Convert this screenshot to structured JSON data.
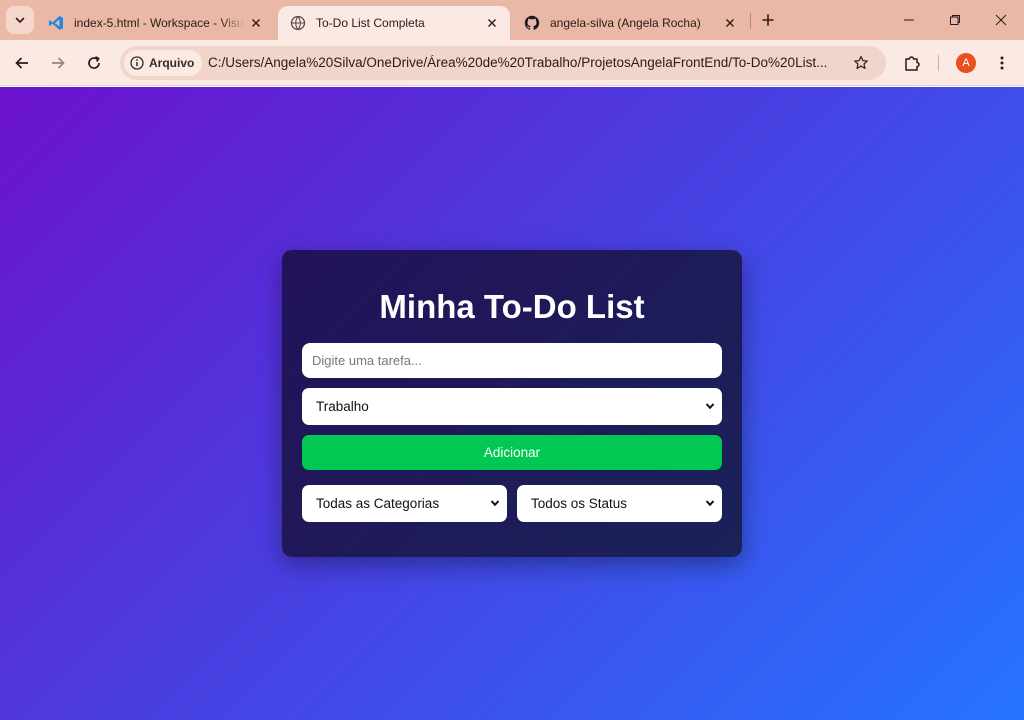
{
  "browser": {
    "tabs": [
      {
        "label": "index-5.html - Workspace - Visual Studio Code",
        "icon": "vscode-icon",
        "active": false
      },
      {
        "label": "To-Do List Completa",
        "icon": "globe-icon",
        "active": true
      },
      {
        "label": "angela-silva (Angela Rocha)",
        "icon": "github-icon",
        "active": false
      }
    ],
    "address": {
      "chip_label": "Arquivo",
      "url": "C:/Users/Angela%20Silva/OneDrive/Área%20de%20Trabalho/ProjetosAngelaFrontEnd/To-Do%20List..."
    },
    "profile_initial": "A"
  },
  "app": {
    "title": "Minha To-Do List",
    "task_input": {
      "placeholder": "Digite uma tarefa...",
      "value": ""
    },
    "category_select": {
      "selected": "Trabalho"
    },
    "add_button_label": "Adicionar",
    "filter_category": {
      "selected": "Todas as Categorias"
    },
    "filter_status": {
      "selected": "Todos os Status"
    }
  },
  "colors": {
    "tabstrip_bg": "#e9b8a6",
    "toolbar_bg": "#fbe9e3",
    "page_gradient_start": "#6c12cc",
    "page_gradient_end": "#2574ff",
    "card_bg": "#23125a",
    "add_button": "#00c853",
    "profile_avatar": "#e8501f"
  }
}
